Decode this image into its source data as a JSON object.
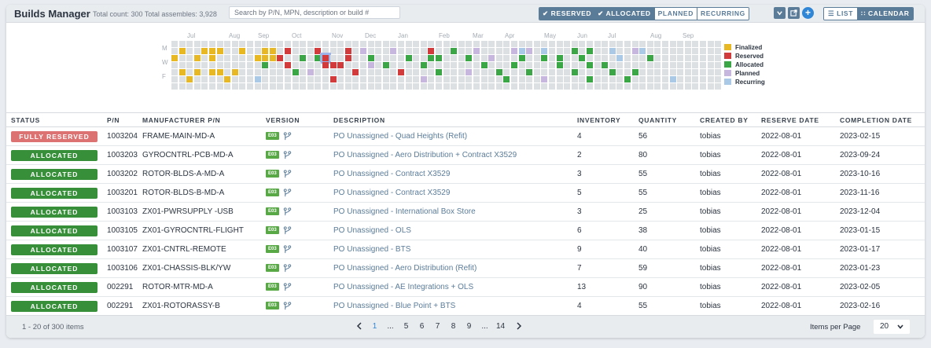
{
  "header": {
    "title": "Builds Manager",
    "subtitle": "Total count: 300 Total assembles: 3,928",
    "search_placeholder": "Search by P/N, MPN, description or build #",
    "filters": [
      {
        "label": "✔ RESERVED",
        "active": true
      },
      {
        "label": "✔ ALLOCATED",
        "active": true
      },
      {
        "label": "PLANNED",
        "active": false
      },
      {
        "label": "RECURRING",
        "active": false
      }
    ],
    "icons": [
      "chevron-down-icon",
      "export-icon",
      "add-icon"
    ],
    "view_list": "☰ LIST",
    "view_calendar": "∷ CALENDAR",
    "view_active": "calendar"
  },
  "calendar": {
    "months": [
      "Jul",
      "Aug",
      "Sep",
      "Oct",
      "Nov",
      "Dec",
      "Jan",
      "Feb",
      "Mar",
      "Apr",
      "May",
      "Jun",
      "Jul",
      "Aug",
      "Sep"
    ],
    "day_labels": [
      "M",
      "W",
      "F"
    ],
    "legend": [
      {
        "label": "Finalized",
        "color": "#e8b824"
      },
      {
        "label": "Reserved",
        "color": "#d23b3b"
      },
      {
        "label": "Allocated",
        "color": "#3aa646"
      },
      {
        "label": "Planned",
        "color": "#c7b6de"
      },
      {
        "label": "Recurring",
        "color": "#a9c9e6"
      }
    ]
  },
  "table": {
    "columns": [
      "STATUS",
      "P/N",
      "MANUFACTURER P/N",
      "VERSION",
      "DESCRIPTION",
      "INVENTORY",
      "QUANTITY",
      "CREATED BY",
      "RESERVE DATE",
      "COMPLETION DATE"
    ],
    "rows": [
      {
        "status": "FULLY RESERVED",
        "status_color": "#dd7272",
        "pn": "1003204",
        "mpn": "FRAME-MAIN-MD-A",
        "version": "E03",
        "description": "PO Unassigned - Quad Heights (Refit)",
        "inventory": "4",
        "quantity": "56",
        "created_by": "tobias",
        "reserve_date": "2022-08-01",
        "completion_date": "2023-02-15"
      },
      {
        "status": "ALLOCATED",
        "status_color": "#378f3a",
        "pn": "1003203",
        "mpn": "GYROCNTRL-PCB-MD-A",
        "version": "E03",
        "description": "PO Unassigned - Aero Distribution + Contract X3529",
        "inventory": "2",
        "quantity": "80",
        "created_by": "tobias",
        "reserve_date": "2022-08-01",
        "completion_date": "2023-09-24"
      },
      {
        "status": "ALLOCATED",
        "status_color": "#378f3a",
        "pn": "1003202",
        "mpn": "ROTOR-BLDS-A-MD-A",
        "version": "E03",
        "description": "PO Unassigned - Contract X3529",
        "inventory": "3",
        "quantity": "55",
        "created_by": "tobias",
        "reserve_date": "2022-08-01",
        "completion_date": "2023-10-16"
      },
      {
        "status": "ALLOCATED",
        "status_color": "#378f3a",
        "pn": "1003201",
        "mpn": "ROTOR-BLDS-B-MD-A",
        "version": "E03",
        "description": "PO Unassigned - Contract X3529",
        "inventory": "5",
        "quantity": "55",
        "created_by": "tobias",
        "reserve_date": "2022-08-01",
        "completion_date": "2023-11-16"
      },
      {
        "status": "ALLOCATED",
        "status_color": "#378f3a",
        "pn": "1003103",
        "mpn": "ZX01-PWRSUPPLY -USB",
        "version": "E03",
        "description": "PO Unassigned - International Box Store",
        "inventory": "3",
        "quantity": "25",
        "created_by": "tobias",
        "reserve_date": "2022-08-01",
        "completion_date": "2023-12-04"
      },
      {
        "status": "ALLOCATED",
        "status_color": "#378f3a",
        "pn": "1003105",
        "mpn": "ZX01-GYROCNTRL-FLIGHT",
        "version": "E03",
        "description": "PO Unassigned - OLS",
        "inventory": "6",
        "quantity": "38",
        "created_by": "tobias",
        "reserve_date": "2022-08-01",
        "completion_date": "2023-01-15"
      },
      {
        "status": "ALLOCATED",
        "status_color": "#378f3a",
        "pn": "1003107",
        "mpn": "ZX01-CNTRL-REMOTE",
        "version": "E03",
        "description": "PO Unassigned - BTS",
        "inventory": "9",
        "quantity": "40",
        "created_by": "tobias",
        "reserve_date": "2022-08-01",
        "completion_date": "2023-01-17"
      },
      {
        "status": "ALLOCATED",
        "status_color": "#378f3a",
        "pn": "1003106",
        "mpn": "ZX01-CHASSIS-BLK/YW",
        "version": "E03",
        "description": "PO Unassigned - Aero Distribution (Refit)",
        "inventory": "7",
        "quantity": "59",
        "created_by": "tobias",
        "reserve_date": "2022-08-01",
        "completion_date": "2023-01-23"
      },
      {
        "status": "ALLOCATED",
        "status_color": "#378f3a",
        "pn": "002291",
        "mpn": "ROTOR-MTR-MD-A",
        "version": "E03",
        "description": "PO Unassigned - AE Integrations + OLS",
        "inventory": "13",
        "quantity": "90",
        "created_by": "tobias",
        "reserve_date": "2022-08-01",
        "completion_date": "2023-02-05"
      },
      {
        "status": "ALLOCATED",
        "status_color": "#378f3a",
        "pn": "002291",
        "mpn": "ZX01-ROTORASSY-B",
        "version": "E03",
        "description": "PO Unassigned - Blue Point + BTS",
        "inventory": "4",
        "quantity": "55",
        "created_by": "tobias",
        "reserve_date": "2022-08-01",
        "completion_date": "2023-02-16"
      }
    ]
  },
  "footer": {
    "count": "1 - 20 of 300 items",
    "pages": [
      "1",
      "...",
      "5",
      "6",
      "7",
      "8",
      "9",
      "...",
      "14"
    ],
    "current_page": "1",
    "items_per_page_label": "Items per Page",
    "items_per_page_value": "20"
  }
}
